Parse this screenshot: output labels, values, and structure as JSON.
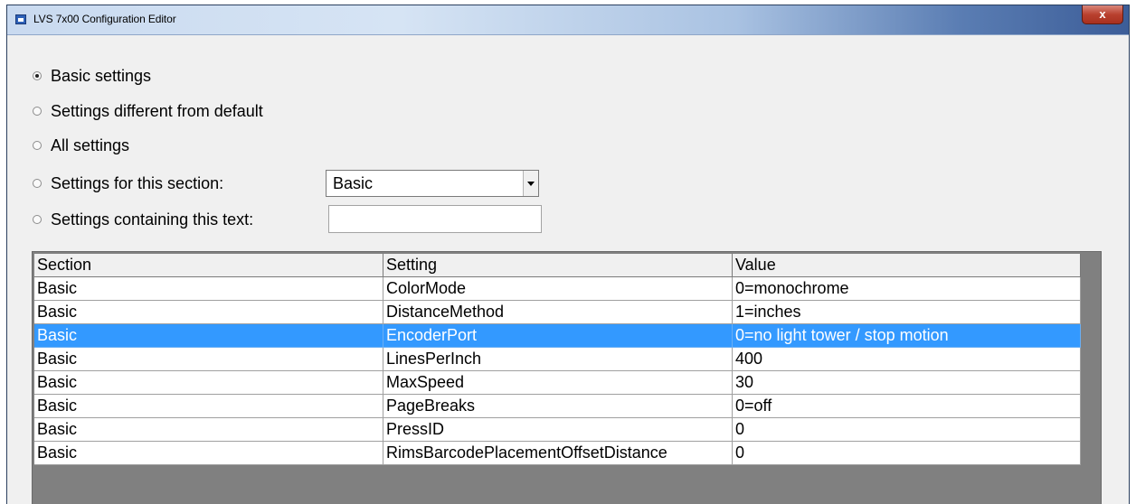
{
  "window": {
    "title": "LVS 7x00 Configuration Editor",
    "close_label": "x"
  },
  "filters": {
    "options": [
      {
        "label": "Basic settings",
        "checked": true
      },
      {
        "label": "Settings different from default",
        "checked": false
      },
      {
        "label": "All settings",
        "checked": false
      },
      {
        "label": "Settings for this section:",
        "checked": false
      },
      {
        "label": "Settings containing this text:",
        "checked": false
      }
    ],
    "section_select": {
      "value": "Basic"
    },
    "text_search": {
      "value": ""
    }
  },
  "grid": {
    "columns": [
      "Section",
      "Setting",
      "Value"
    ],
    "rows": [
      {
        "section": "Basic",
        "setting": "ColorMode",
        "value": "0=monochrome",
        "selected": false
      },
      {
        "section": "Basic",
        "setting": "DistanceMethod",
        "value": "1=inches",
        "selected": false
      },
      {
        "section": "Basic",
        "setting": "EncoderPort",
        "value": "0=no light tower / stop motion",
        "selected": true
      },
      {
        "section": "Basic",
        "setting": "LinesPerInch",
        "value": "400",
        "selected": false
      },
      {
        "section": "Basic",
        "setting": "MaxSpeed",
        "value": "30",
        "selected": false
      },
      {
        "section": "Basic",
        "setting": "PageBreaks",
        "value": "0=off",
        "selected": false
      },
      {
        "section": "Basic",
        "setting": "PressID",
        "value": "0",
        "selected": false
      },
      {
        "section": "Basic",
        "setting": "RimsBarcodePlacementOffsetDistance",
        "value": "0",
        "selected": false
      }
    ]
  }
}
